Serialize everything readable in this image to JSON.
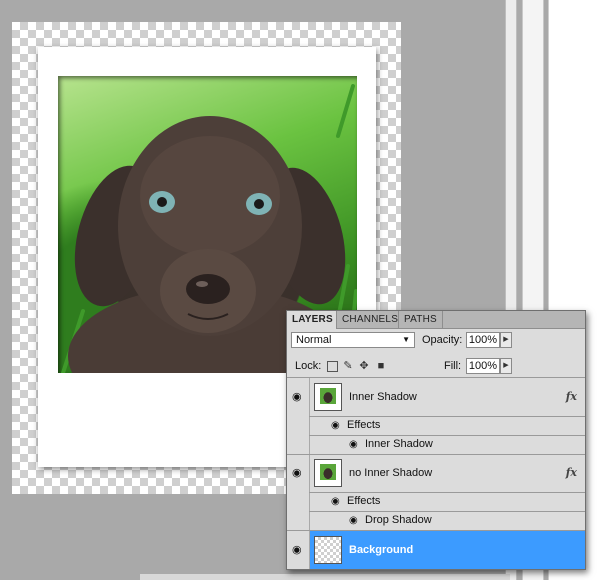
{
  "panel": {
    "tabs": [
      {
        "label": "LAYERS",
        "active": true
      },
      {
        "label": "CHANNELS",
        "active": false
      },
      {
        "label": "PATHS",
        "active": false
      }
    ],
    "blend_mode": "Normal",
    "opacity_label": "Opacity:",
    "opacity_value": "100%",
    "lock_label": "Lock:",
    "fill_label": "Fill:",
    "fill_value": "100%",
    "layers": [
      {
        "name": "Inner Shadow",
        "fx": "fx",
        "effects_label": "Effects",
        "effects": [
          "Inner Shadow"
        ],
        "selected": false
      },
      {
        "name": "no Inner Shadow",
        "fx": "fx",
        "effects_label": "Effects",
        "effects": [
          "Drop Shadow"
        ],
        "selected": false
      },
      {
        "name": "Background",
        "selected": true
      }
    ]
  },
  "colors": {
    "selection": "#3c9bff",
    "panel_bg": "#dcdcdc",
    "workspace": "#a9a9a9"
  },
  "icons": [
    "eye-icon",
    "lock-transparent-icon",
    "lock-brush-icon",
    "lock-move-icon",
    "lock-all-icon",
    "fx-icon",
    "dropdown-arrow-icon",
    "spin-arrow-icon"
  ]
}
